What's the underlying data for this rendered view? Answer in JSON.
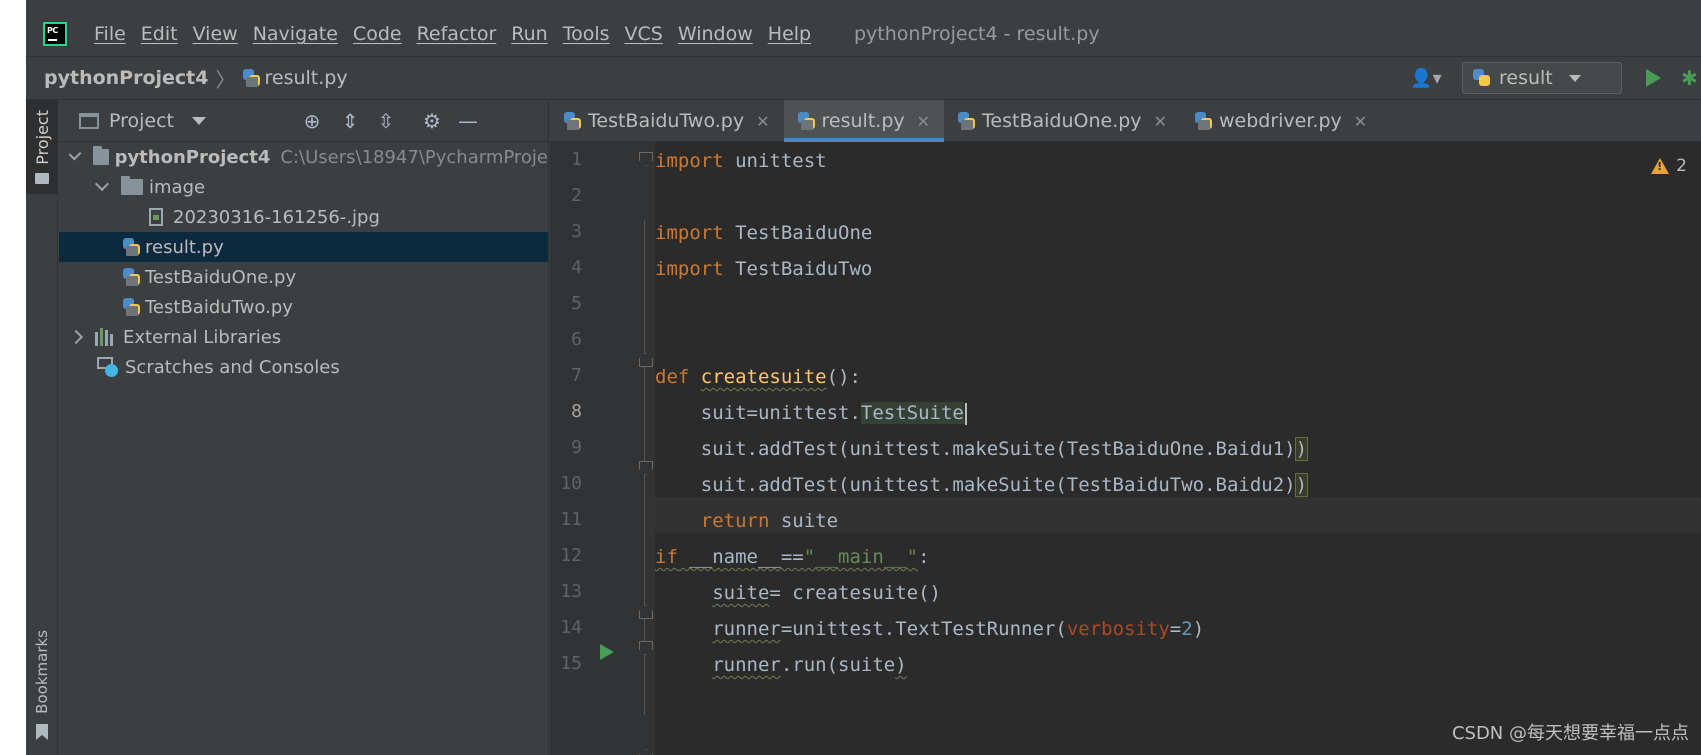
{
  "menu": {
    "items": [
      "File",
      "Edit",
      "View",
      "Navigate",
      "Code",
      "Refactor",
      "Run",
      "Tools",
      "VCS",
      "Window",
      "Help"
    ],
    "window_title": "pythonProject4 - result.py"
  },
  "app_logo_text": "PC",
  "breadcrumb": {
    "project": "pythonProject4",
    "file": "result.py"
  },
  "run_config": {
    "label": "result"
  },
  "tool_stripe": {
    "project_label": "Project",
    "bookmarks_label": "Bookmarks"
  },
  "project_panel": {
    "title": "Project",
    "tree": {
      "root_name": "pythonProject4",
      "root_path": "C:\\Users\\18947\\PycharmProje",
      "image_folder": "image",
      "image_file": "20230316-161256-.jpg",
      "result_file": "result.py",
      "one_file": "TestBaiduOne.py",
      "two_file": "TestBaiduTwo.py",
      "external_libraries": "External Libraries",
      "scratches": "Scratches and Consoles"
    }
  },
  "tabs": [
    {
      "label": "TestBaiduTwo.py",
      "active": false
    },
    {
      "label": "result.py",
      "active": true
    },
    {
      "label": "TestBaiduOne.py",
      "active": false
    },
    {
      "label": "webdriver.py",
      "active": false
    }
  ],
  "editor": {
    "line_numbers": [
      "1",
      "2",
      "3",
      "4",
      "5",
      "6",
      "7",
      "8",
      "9",
      "10",
      "11",
      "12",
      "13",
      "14",
      "15"
    ],
    "current_line": 8,
    "warning_count": "2",
    "code": {
      "l1_kw": "import",
      "l1_rest": " unittest",
      "l3_kw": "import",
      "l3_rest": " TestBaiduOne",
      "l4_kw": "import",
      "l4_rest": " TestBaiduTwo",
      "l7_kw": "def",
      "l7_fn": "createsuite",
      "l7_rest": "():",
      "l8_indent": "    ",
      "l8_a": "suit",
      "l8_b": "=unittest.",
      "l8_c": "TestSuite",
      "l9_a": "    suit.addTest(unittest.makeSuite(TestBaiduOne.Baidu1)",
      "l9_b": ")",
      "l10_a": "    suit.addTest(unittest.makeSuite(TestBaiduTwo.Baidu2)",
      "l10_b": ")",
      "l11_indent": "    ",
      "l11_kw": "return",
      "l11_rest": " suite",
      "l12_kw": "if",
      "l12_a": " __name__==",
      "l12_str": "\"__main__\"",
      "l12_b": ":",
      "l13_indent": "     ",
      "l13_a": "suite",
      "l13_b": "= createsuite()",
      "l14_indent": "     ",
      "l14_a": "runner",
      "l14_b": "=unittest.TextTestRunner(",
      "l14_param": "verbosity",
      "l14_eq": "=",
      "l14_num": "2",
      "l14_c": ")",
      "l15_indent": "     ",
      "l15_a": "runner",
      "l15_b": ".run(suite",
      "l15_c": ")"
    }
  },
  "watermark": "CSDN @每天想要幸福一点点"
}
